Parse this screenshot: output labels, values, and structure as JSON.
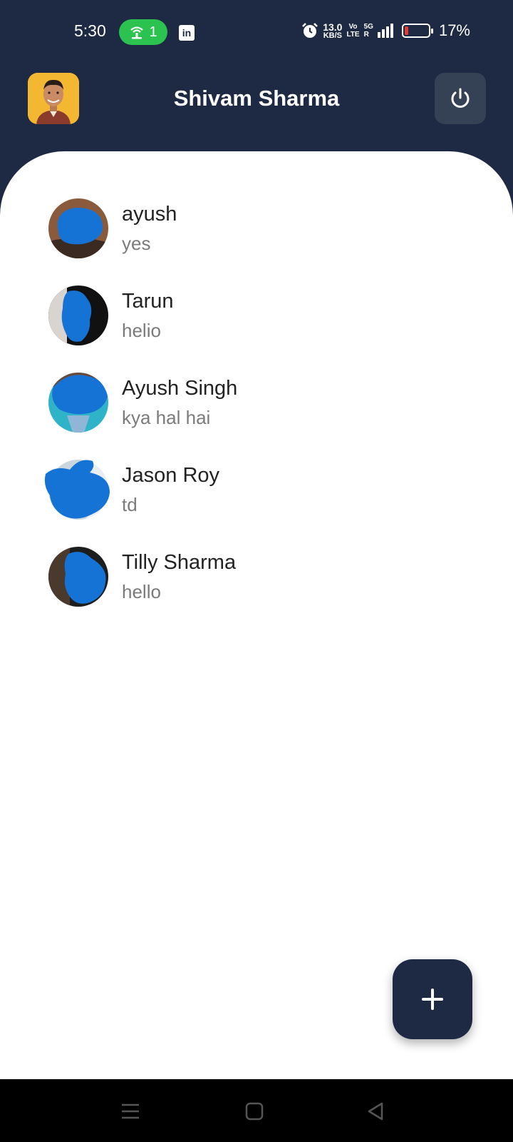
{
  "status_bar": {
    "time": "5:30",
    "hotspot_count": "1",
    "linkedin_label": "in",
    "net_speed": "13.0",
    "net_speed_unit": "KB/S",
    "volte_top": "Vo",
    "volte_bottom": "LTE",
    "network_type": "5G",
    "network_sub": "R",
    "battery_percent": "17%",
    "battery_level": 0.17
  },
  "header": {
    "title": "Shivam Sharma"
  },
  "chats": [
    {
      "name": "ayush",
      "message": "yes"
    },
    {
      "name": "Tarun",
      "message": "helio"
    },
    {
      "name": "Ayush Singh",
      "message": "kya hal hai"
    },
    {
      "name": "Jason Roy",
      "message": "td"
    },
    {
      "name": "Tilly Sharma",
      "message": "hello"
    }
  ],
  "colors": {
    "primary": "#1e2a44",
    "hotspot_green": "#2bc24f",
    "scribble_blue": "#1673d6"
  },
  "icons": {
    "power": "power-icon",
    "add": "plus-icon",
    "nav_menu": "menu-icon",
    "nav_home": "home-square-icon",
    "nav_back": "back-triangle-icon"
  }
}
